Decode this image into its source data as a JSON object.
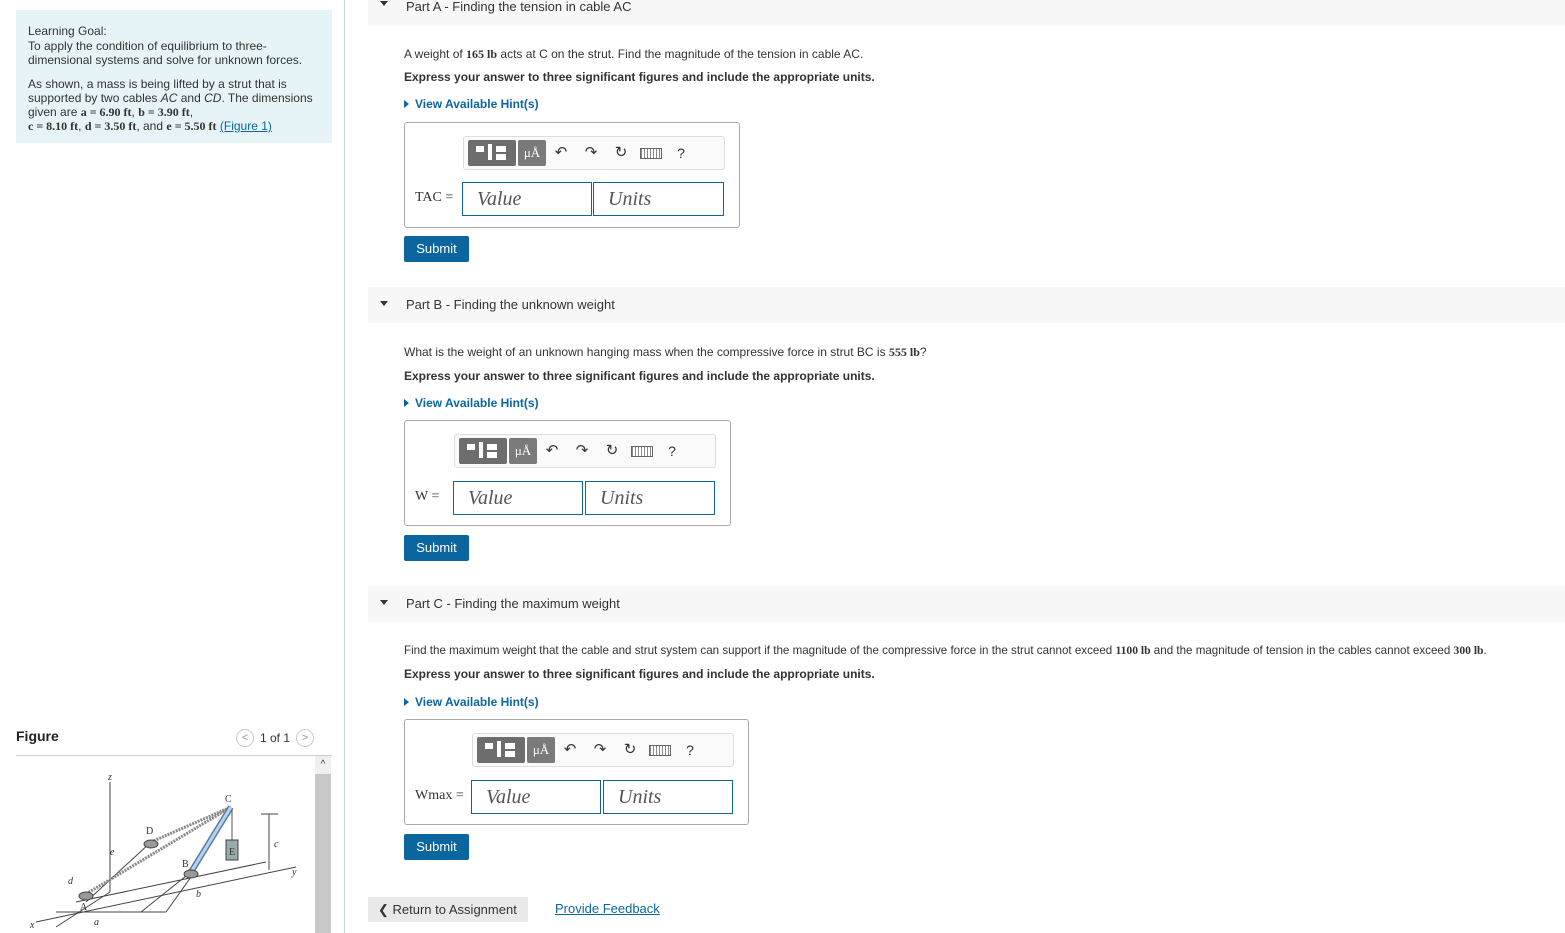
{
  "learning_goal": {
    "title": "Learning Goal:",
    "objective": "To apply the condition of equilibrium to three-dimensional systems and solve for unknown forces.",
    "description_intro": "As shown, a mass is being lifted by a strut that is supported by two cables ",
    "cable1": "AC",
    "and": " and ",
    "cable2": "CD",
    "dims_intro": ". The dimensions given are ",
    "a_val": "a = 6.90 ft",
    "b_val": "b = 3.90 ft",
    "c_val": "c = 8.10 ft",
    "d_val": "d = 3.50 ft",
    "and_e": ", and ",
    "e_val": "e = 5.50 ft",
    "figure_link": "(Figure 1)"
  },
  "figure_panel": {
    "title": "Figure",
    "pager": "1 of 1",
    "prev": "<",
    "next": ">",
    "scroll_up": "^",
    "labels": {
      "z": "z",
      "C": "C",
      "D": "D",
      "e": "e",
      "c": "c",
      "B": "B",
      "E": "E",
      "d": "d",
      "y": "y",
      "A": "A",
      "b": "b",
      "a": "a",
      "x": "x"
    }
  },
  "parts": [
    {
      "letter": "Part A",
      "title": " - Finding the tension in cable AC",
      "question_pre": "A weight of ",
      "question_val": "165 lb",
      "question_post": " acts at C on the strut. Find the magnitude of the tension in cable AC.",
      "instruction": "Express your answer to three significant figures and include the appropriate units.",
      "hint": "View Available Hint(s)",
      "var_label": "TAC =",
      "value_placeholder": "Value",
      "units_placeholder": "Units",
      "submit": "Submit"
    },
    {
      "letter": "Part B",
      "title": " - Finding the unknown weight",
      "question_pre": "What is the weight of an unknown hanging mass when the compressive force in strut BC is ",
      "question_val": "555 lb",
      "question_post": "?",
      "instruction": "Express your answer to three significant figures and include the appropriate units.",
      "hint": "View Available Hint(s)",
      "var_label": "W =",
      "value_placeholder": "Value",
      "units_placeholder": "Units",
      "submit": "Submit"
    },
    {
      "letter": "Part C",
      "title": " - Finding the maximum weight",
      "question_pre": "Find the maximum weight that the cable and strut system can support if the magnitude of the compressive force in the strut cannot exceed ",
      "question_val": "1100 lb",
      "question_mid": " and the magnitude of tension in the cables cannot exceed ",
      "question_val2": "300 lb",
      "question_post": ".",
      "instruction": "Express your answer to three significant figures and include the appropriate units.",
      "hint": "View Available Hint(s)",
      "var_label": "Wmax =",
      "value_placeholder": "Value",
      "units_placeholder": "Units",
      "submit": "Submit"
    }
  ],
  "toolbar": {
    "mu": "μÅ",
    "help": "?"
  },
  "footer": {
    "return_label": "Return to Assignment",
    "feedback_label": "Provide Feedback"
  }
}
